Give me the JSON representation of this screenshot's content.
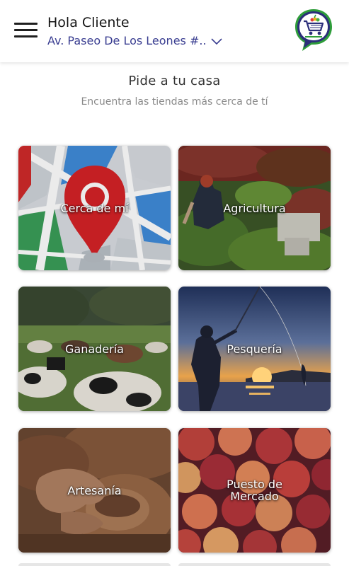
{
  "header": {
    "greeting": "Hola Cliente",
    "address": "Av. Paseo De Los Leones #..",
    "logo_name": "market-cart-chat-logo",
    "menu_icon": "hamburger-menu-icon",
    "dropdown_icon": "chevron-down-icon"
  },
  "intro": {
    "title": "Pide a tu casa",
    "subtitle": "Encuentra las tiendas más cerca de tí"
  },
  "categories": [
    {
      "label": "Cerca de mí",
      "image": "map-pin"
    },
    {
      "label": "Agricultura",
      "image": "farming"
    },
    {
      "label": "Ganadería",
      "image": "cattle"
    },
    {
      "label": "Pesquería",
      "image": "fishing-sunset"
    },
    {
      "label": "Artesanía",
      "image": "pottery"
    },
    {
      "label": "Puesto de\nMercado",
      "image": "plums"
    }
  ],
  "colors": {
    "address_text": "#3a3e91",
    "logo_green": "#2e9d3a",
    "logo_navy": "#2b2e7a"
  }
}
